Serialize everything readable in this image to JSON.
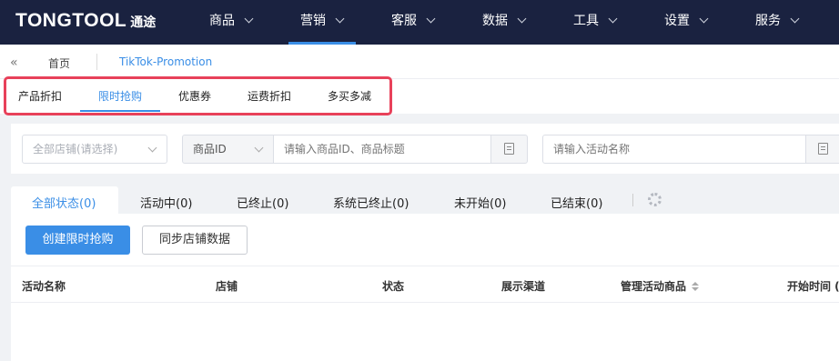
{
  "brand": {
    "logo_text": "TONGTOOL",
    "logo_cn": "通途"
  },
  "topnav": [
    {
      "label": "商品",
      "active": false
    },
    {
      "label": "营销",
      "active": true
    },
    {
      "label": "客服",
      "active": false
    },
    {
      "label": "数据",
      "active": false
    },
    {
      "label": "工具",
      "active": false
    },
    {
      "label": "设置",
      "active": false
    },
    {
      "label": "服务",
      "active": false
    }
  ],
  "breadcrumb": {
    "collapse_glyph": "«",
    "home": "首页",
    "current": "TikTok-Promotion"
  },
  "subtabs": [
    {
      "label": "产品折扣",
      "active": false
    },
    {
      "label": "限时抢购",
      "active": true
    },
    {
      "label": "优惠券",
      "active": false
    },
    {
      "label": "运费折扣",
      "active": false
    },
    {
      "label": "多买多减",
      "active": false
    }
  ],
  "filters": {
    "store_select_placeholder": "全部店铺(请选择)",
    "id_type_value": "商品ID",
    "product_search_placeholder": "请输入商品ID、商品标题",
    "activity_name_placeholder": "请输入活动名称"
  },
  "status_tabs": [
    {
      "label": "全部状态(0)",
      "active": true
    },
    {
      "label": "活动中(0)",
      "active": false
    },
    {
      "label": "已终止(0)",
      "active": false
    },
    {
      "label": "系统已终止(0)",
      "active": false
    },
    {
      "label": "未开始(0)",
      "active": false
    },
    {
      "label": "已结束(0)",
      "active": false
    }
  ],
  "actions": {
    "create_label": "创建限时抢购",
    "sync_label": "同步店铺数据"
  },
  "table": {
    "columns": [
      "活动名称",
      "店铺",
      "状态",
      "展示渠道",
      "管理活动商品",
      "开始时间 ("
    ]
  },
  "colors": {
    "nav_bg": "#1a2240",
    "accent": "#3a8ee6",
    "highlight": "#e8415a"
  }
}
